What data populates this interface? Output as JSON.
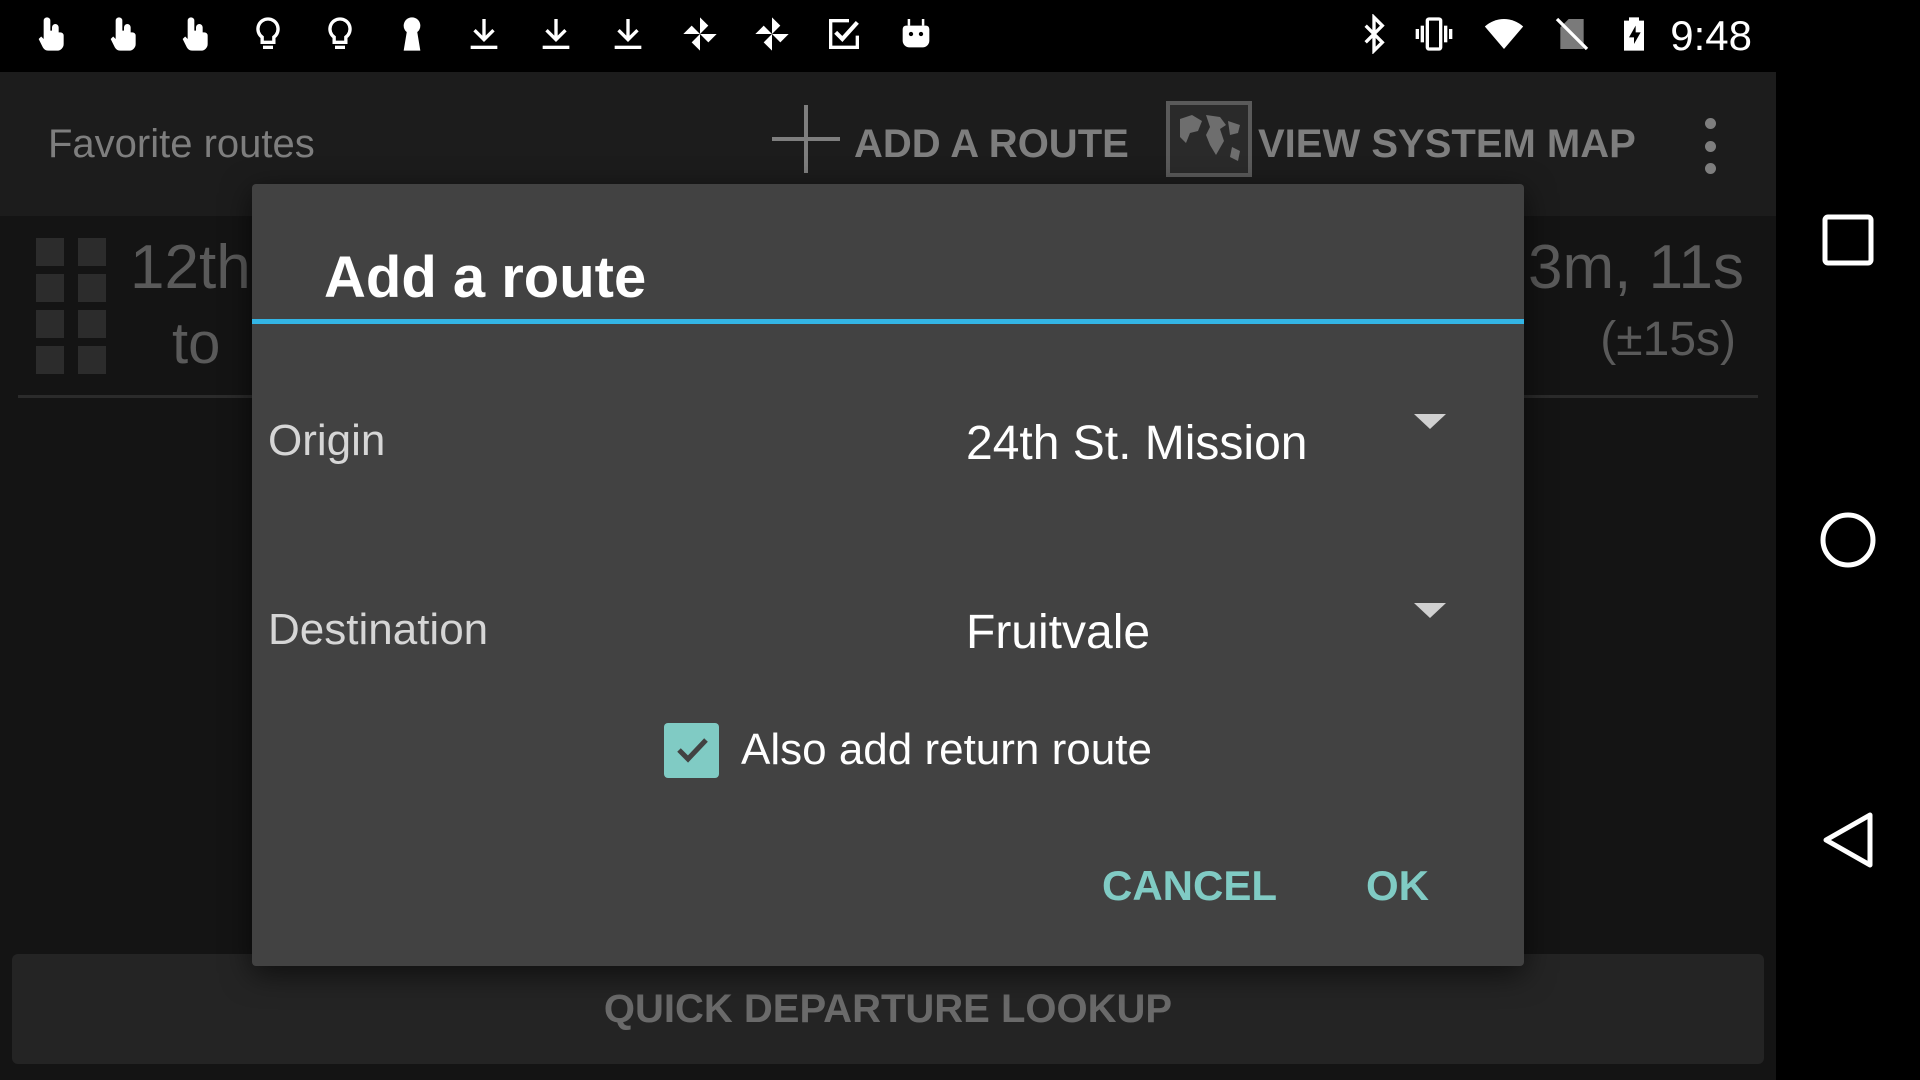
{
  "status_bar": {
    "notification_icons": [
      "touch-icon",
      "touch-icon",
      "touch-icon",
      "lightbulb-icon",
      "lightbulb-icon",
      "keyhole-icon",
      "download-icon",
      "download-icon",
      "download-icon",
      "pinwheel-icon",
      "pinwheel-icon",
      "checkbox-icon",
      "android-icon"
    ],
    "system_icons": [
      "bluetooth-icon",
      "vibrate-icon",
      "wifi-icon",
      "no-sim-icon",
      "battery-charging-icon"
    ],
    "time": "9:48"
  },
  "action_bar": {
    "title": "Favorite routes",
    "add_route_label": "ADD A ROUTE",
    "view_map_label": "VIEW SYSTEM MAP"
  },
  "route_row": {
    "origin_partial": "12th",
    "to_partial": "to",
    "time": "3m, 11s",
    "uncertainty": "(±15s)"
  },
  "quick_lookup_label": "QUICK DEPARTURE LOOKUP",
  "dialog": {
    "title": "Add a route",
    "origin_label": "Origin",
    "origin_value": "24th St. Mission",
    "destination_label": "Destination",
    "destination_value": "Fruitvale",
    "return_route_label": "Also add return route",
    "return_route_checked": true,
    "cancel_label": "CANCEL",
    "ok_label": "OK"
  },
  "colors": {
    "accent": "#80cbc4",
    "divider": "#33b5e5",
    "dialog_bg": "#424242"
  }
}
